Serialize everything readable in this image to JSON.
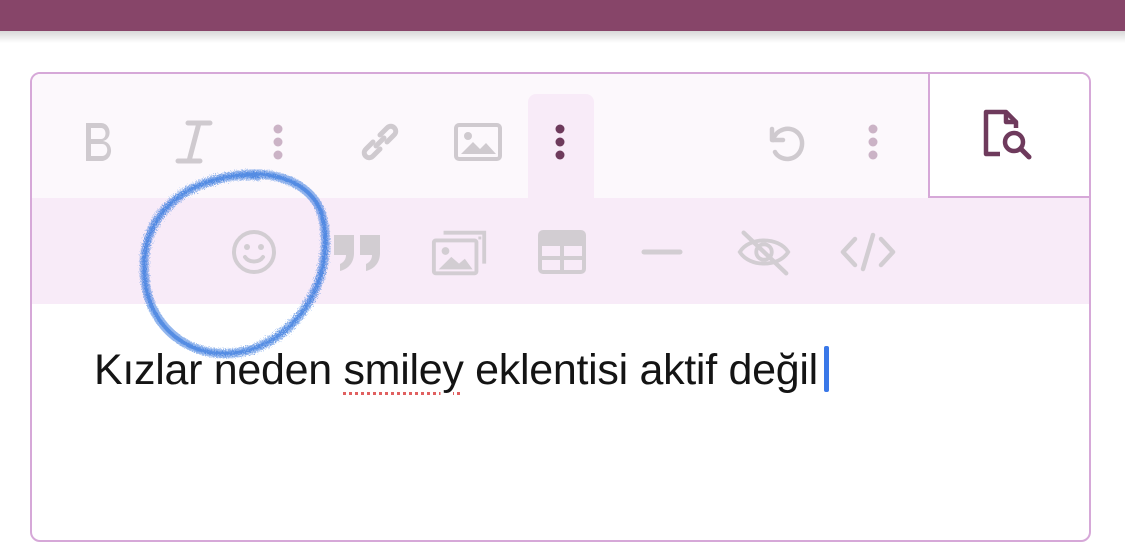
{
  "toolbar": {
    "row1": [
      {
        "name": "bold-button",
        "icon": "bold-icon"
      },
      {
        "name": "italic-button",
        "icon": "italic-icon"
      },
      {
        "name": "text-more-button",
        "icon": "more-vertical-icon"
      },
      {
        "name": "link-button",
        "icon": "link-icon"
      },
      {
        "name": "image-button",
        "icon": "image-icon"
      },
      {
        "name": "insert-more-button",
        "icon": "more-vertical-icon",
        "active": true
      },
      {
        "name": "undo-button",
        "icon": "undo-icon"
      },
      {
        "name": "options-more-button",
        "icon": "more-vertical-icon"
      },
      {
        "name": "preview-button",
        "icon": "document-search-icon"
      }
    ],
    "row2": [
      {
        "name": "smilie-button",
        "icon": "smiley-icon"
      },
      {
        "name": "quote-button",
        "icon": "quote-icon"
      },
      {
        "name": "media-button",
        "icon": "media-gallery-icon"
      },
      {
        "name": "table-button",
        "icon": "table-icon"
      },
      {
        "name": "horizontal-line-button",
        "icon": "minus-icon"
      },
      {
        "name": "spoiler-button",
        "icon": "eye-slash-icon"
      },
      {
        "name": "code-button",
        "icon": "code-icon"
      }
    ]
  },
  "content": {
    "before": "Kızlar neden ",
    "misspelled": "smiley",
    "after": " eklentisi aktif değil"
  },
  "colors": {
    "brand": "#874569",
    "border": "#d6a8d8",
    "toolbar_bg": "#fcf8fc",
    "row2_bg": "#f8ebf8",
    "icon_disabled": "#c8c4c8",
    "icon_active": "#6e3a5c",
    "caret": "#3a78e8",
    "annotation": "#3a7be0"
  }
}
